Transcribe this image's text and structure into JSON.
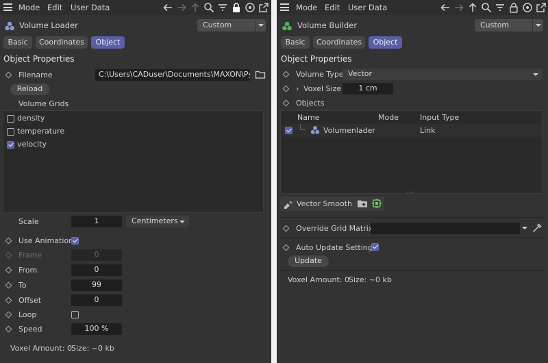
{
  "left": {
    "menu": [
      "Mode",
      "Edit",
      "User Data"
    ],
    "object_name": "Volume Loader",
    "layer": "Custom",
    "tabs": [
      "Basic",
      "Coordinates",
      "Object"
    ],
    "section_title": "Object Properties",
    "filename_label": "Filename",
    "filename_value": "C:\\Users\\CADuser\\Documents\\MAXON\\Pyro",
    "reload_label": "Reload",
    "volume_grids_label": "Volume Grids",
    "grids": [
      {
        "name": "density",
        "checked": false
      },
      {
        "name": "temperature",
        "checked": false
      },
      {
        "name": "velocity",
        "checked": true
      }
    ],
    "scale_label": "Scale",
    "scale_value": "1",
    "scale_unit": "Centimeters",
    "use_animation_label": "Use Animation",
    "use_animation_checked": true,
    "frame_label": "Frame",
    "frame_value": "0",
    "from_label": "From",
    "from_value": "0",
    "to_label": "To",
    "to_value": "99",
    "offset_label": "Offset",
    "offset_value": "0",
    "loop_label": "Loop",
    "loop_checked": false,
    "speed_label": "Speed",
    "speed_value": "100 %",
    "voxel_amount": "Voxel Amount: 0",
    "size": "Size: ~0 kb"
  },
  "right": {
    "menu": [
      "Mode",
      "Edit",
      "User Data"
    ],
    "object_name": "Volume Builder",
    "layer": "Custom",
    "tabs": [
      "Basic",
      "Coordinates",
      "Object"
    ],
    "section_title": "Object Properties",
    "volume_type_label": "Volume Type",
    "volume_type_value": "Vector",
    "voxel_size_label": "Voxel Size",
    "voxel_size_value": "1 cm",
    "objects_label": "Objects",
    "columns": [
      "Name",
      "Mode",
      "Input Type"
    ],
    "rows": [
      {
        "name": "Volumenlader",
        "mode": "",
        "input_type": "Link",
        "checked": true
      }
    ],
    "filter_button": "Vector Smooth",
    "override_grid_label": "Override Grid Matrix",
    "override_grid_value": "",
    "auto_update_label": "Auto Update Settings",
    "auto_update_checked": true,
    "update_button": "Update",
    "voxel_amount": "Voxel Amount: 0",
    "size": "Size: ~0 kb"
  },
  "colors": {
    "accent": "#5a5fa8",
    "panel": "#333333",
    "field": "#1f1f1f",
    "loader_icon": "#8a9bd0",
    "builder_icon": "#4fb35a"
  },
  "icons": [
    "hamburger-icon",
    "arrow-left-icon",
    "arrow-right-icon",
    "arrow-up-icon",
    "search-icon",
    "filter-icon",
    "lock-icon",
    "target-icon",
    "popout-icon",
    "folder-icon",
    "eyedropper-icon",
    "add-folder-icon",
    "add-filter-icon",
    "pencil-filter-icon"
  ]
}
